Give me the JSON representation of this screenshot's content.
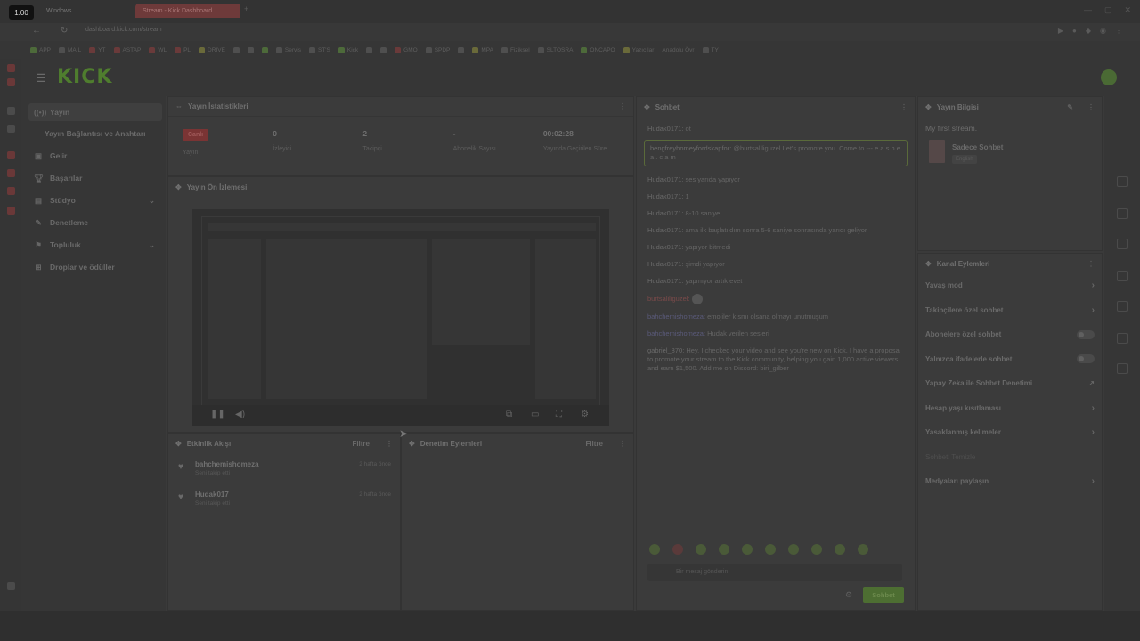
{
  "browser": {
    "zoom": "1.00",
    "tabs": [
      {
        "label": "Windows",
        "active": false
      },
      {
        "label": "Stream - Kick Dashboard",
        "active": true
      }
    ],
    "url": "dashboard.kick.com/stream",
    "bookmarks": [
      "APP",
      "MAIL",
      "YT",
      "ASTAP",
      "WL",
      "PL",
      "DRIVE",
      "Servis",
      "ST'S",
      "Kick",
      "GMO",
      "SPDP",
      "MPA",
      "Fiziksel",
      "SLTOSRA",
      "ONCAPO",
      "Yazıcılar",
      "Anadolu Övr",
      "TY"
    ]
  },
  "header": {
    "logo": "KICK"
  },
  "sidebar": {
    "items": [
      {
        "label": "Yayın",
        "icon": "broadcast-icon",
        "active": true
      },
      {
        "label": "Yayın Bağlantısı ve Anahtarı",
        "icon": "",
        "active": false
      },
      {
        "label": "Gelir",
        "icon": "dollar-icon",
        "active": false
      },
      {
        "label": "Başarılar",
        "icon": "trophy-icon",
        "active": false
      },
      {
        "label": "Stüdyo",
        "icon": "studio-icon",
        "active": false,
        "expandable": true
      },
      {
        "label": "Denetleme",
        "icon": "wrench-icon",
        "active": false
      },
      {
        "label": "Topluluk",
        "icon": "community-icon",
        "active": false,
        "expandable": true
      },
      {
        "label": "Droplar ve ödüller",
        "icon": "gift-icon",
        "active": false
      }
    ]
  },
  "stats_panel": {
    "title": "Yayın İstatistikleri",
    "stats": [
      {
        "value": "Canlı",
        "label": "Yayın",
        "badge": true
      },
      {
        "value": "0",
        "label": "İzleyici"
      },
      {
        "value": "2",
        "label": "Takipçi"
      },
      {
        "value": "-",
        "label": "Abonelik Sayısı"
      },
      {
        "value": "00:02:28",
        "label": "Yayında Geçirilen Süre"
      }
    ]
  },
  "preview_panel": {
    "title": "Yayın Ön İzlemesi"
  },
  "activity_panel": {
    "title": "Etkinlik Akışı",
    "filter": "Filtre",
    "items": [
      {
        "name": "bahchemishomeza",
        "sub": "Seni takip etti",
        "time": "2 hafta önce"
      },
      {
        "name": "Hudak017",
        "sub": "Seni takip etti",
        "time": "2 hafta önce"
      }
    ]
  },
  "moderation_panel": {
    "title": "Denetim Eylemleri",
    "filter": "Filtre"
  },
  "chat": {
    "title": "Sohbet",
    "messages": [
      {
        "user": "Hudak0171:",
        "text": "ot",
        "style": "normal"
      },
      {
        "user": "bengfreyhomeyfordskapfor:",
        "text": "@burtsaliliguzel Let's promote you. Come to --- e a s h e a . c a m",
        "style": "pinned"
      },
      {
        "user": "Hudak0171:",
        "text": "ses yarıda yapıyor",
        "style": "normal"
      },
      {
        "user": "Hudak0171:",
        "text": "1",
        "style": "normal"
      },
      {
        "user": "Hudak0171:",
        "text": "8-10 saniye",
        "style": "normal"
      },
      {
        "user": "Hudak0171:",
        "text": "ama ilk başlatıldım sonra 5-6 saniye sonrasında yarıdı geliyor",
        "style": "normal"
      },
      {
        "user": "Hudak0171:",
        "text": "yapıyor bitmedi",
        "style": "normal"
      },
      {
        "user": "Hudak0171:",
        "text": "şimdi yapıyor",
        "style": "normal"
      },
      {
        "user": "Hudak0171:",
        "text": "yapmıyor artık evet",
        "style": "normal"
      },
      {
        "user": "burtsaliliguzel:",
        "text": "",
        "style": "pink"
      },
      {
        "user": "bahchemishomeza:",
        "text": "emojiler kısmı olsana olmayı unutmuşum",
        "style": "blue"
      },
      {
        "user": "bahchemishomeza:",
        "text": "Hudak verilen sesleri",
        "style": "blue"
      },
      {
        "user": "gabriel_870:",
        "text": "Hey, I checked your video and see you're new on Kick. I have a proposal to promote your stream to the Kick community, helping you gain 1,000 active viewers and earn $1,500. Add me on Discord: biri_gilber",
        "style": "normal"
      }
    ],
    "input_placeholder": "Bir mesaj gönderin",
    "send_label": "Sohbet"
  },
  "info_panel": {
    "title": "Yayın Bilgisi",
    "stream_title": "My first stream.",
    "category": "Sadece Sohbet",
    "tag": "English"
  },
  "actions_panel": {
    "title": "Kanal Eylemleri",
    "items": [
      {
        "label": "Yavaş mod",
        "control": "chevron"
      },
      {
        "label": "Takipçilere özel sohbet",
        "control": "chevron"
      },
      {
        "label": "Abonelere özel sohbet",
        "control": "toggle"
      },
      {
        "label": "Yalnızca ifadelerle sohbet",
        "control": "toggle"
      },
      {
        "label": "Yapay Zeka ile Sohbet Denetimi",
        "control": "link"
      },
      {
        "label": "Hesap yaşı kısıtlaması",
        "control": "chevron"
      },
      {
        "label": "Yasaklanmış kelimeler",
        "control": "chevron"
      },
      {
        "label": "Sohbeti Temizle",
        "control": "none",
        "dim": true
      },
      {
        "label": "Medyaları paylaşın",
        "control": "chevron"
      }
    ]
  }
}
